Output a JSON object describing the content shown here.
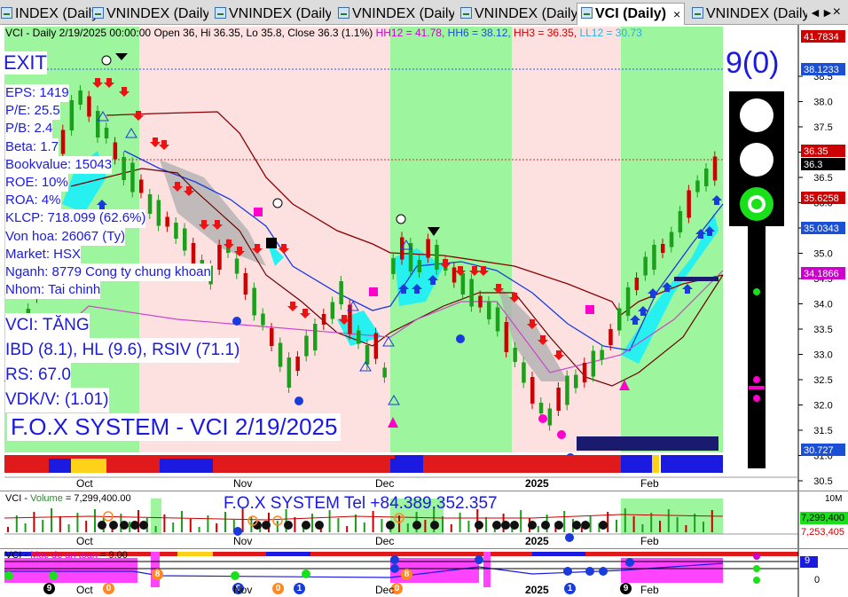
{
  "tabs": [
    {
      "label": "INDEX (Daily)",
      "active": false
    },
    {
      "label": "VNINDEX (Daily)",
      "active": false
    },
    {
      "label": "VNINDEX (Daily)",
      "active": false
    },
    {
      "label": "VNINDEX (Daily)",
      "active": false
    },
    {
      "label": "VNINDEX (Daily)",
      "active": false
    },
    {
      "label": "VCI (Daily)",
      "active": true
    },
    {
      "label": "VNINDEX (Daily)",
      "active": false
    }
  ],
  "tab_close": "×",
  "tab_nav_left": "◄",
  "tab_nav_right": "►",
  "window_close": "×",
  "price_header": {
    "prefix": "VCI - Daily 2/19/2025 00:00:00 Open 36, Hi 36.35, Lo 35.8, Close 36.3 (1.1%) ",
    "hh12": "HH12 = 41.78, ",
    "hh6": "HH6 = 38.12, ",
    "hh3": "HH3 = 36.35, ",
    "ll12": "LL12 = 30.73"
  },
  "signal": {
    "exit": "EXIT",
    "count": "9(0)"
  },
  "fundamentals": [
    "EPS: 1419",
    "P/E: 25.5",
    "P/B: 2.4",
    "Beta: 1.7",
    "Bookvalue: 15043",
    "ROE: 10%",
    "ROA: 4%",
    "KLCP: 718.099 (62.6%)",
    "Von hoa: 26067 (Ty)",
    "Market: HSX",
    "Nganh: 8779 Cong ty chung khoan",
    "Nhom: Tai chinh"
  ],
  "ratings": [
    "VCI: TĂNG",
    "IBD (8.1), HL (9.6), RSIV (71.1)",
    "RS: 67.0",
    "VDK/V:  (1.01)"
  ],
  "brand": "F.O.X SYSTEM - VCI 2/19/2025",
  "price_axis": {
    "ticks": [
      "38.5",
      "38.0",
      "37.5",
      "37.0",
      "36.5",
      "36.0",
      "35.5",
      "35.0",
      "34.5",
      "34.0",
      "33.5",
      "33.0",
      "32.5",
      "32.0",
      "31.5",
      "31.0",
      "30.5"
    ],
    "labels": [
      {
        "text": "41.7834",
        "color": "#cc0000"
      },
      {
        "text": "38.1233",
        "color": "#1a4fd6"
      },
      {
        "text": "36.35",
        "color": "#cc0000"
      },
      {
        "text": "36.3",
        "color": "#000000"
      },
      {
        "text": "35.6258",
        "color": "#cc0000"
      },
      {
        "text": "35.0343",
        "color": "#1a4fd6"
      },
      {
        "text": "34.1866",
        "color": "#cc00cc"
      },
      {
        "text": "30.727",
        "color": "#1a4fd6"
      }
    ]
  },
  "x_axis": [
    "Oct",
    "Nov",
    "Dec",
    "2025",
    "Feb"
  ],
  "volume_pane": {
    "title_prefix": "VCI - ",
    "title_name": "Volume",
    "title_value": " = 7,299,400.00",
    "contact": "F.O.X SYSTEM Tel +84.389.352.357",
    "tick_top": "10M",
    "labels": [
      {
        "text": "7,299,400",
        "color": "#000000"
      },
      {
        "text": "7,253,405",
        "color": "#cc0000"
      }
    ]
  },
  "safety_pane": {
    "title_prefix": "VCI - ",
    "title_name": "Muc do an toan",
    "title_value": " = 9.00",
    "value_label": "9",
    "tick_zero": "0",
    "badges": [
      "9",
      "0",
      "8",
      "0",
      "0",
      "1",
      "0",
      "8",
      "1",
      "9"
    ]
  },
  "colors": {
    "green_zone": "#9df59d",
    "pink_zone": "#fde0e0",
    "up_candle": "#1aa01a",
    "down_candle": "#cc0000",
    "navy": "#1a1a6e",
    "magenta": "#ff00cc",
    "cyan": "#27f0f0"
  }
}
